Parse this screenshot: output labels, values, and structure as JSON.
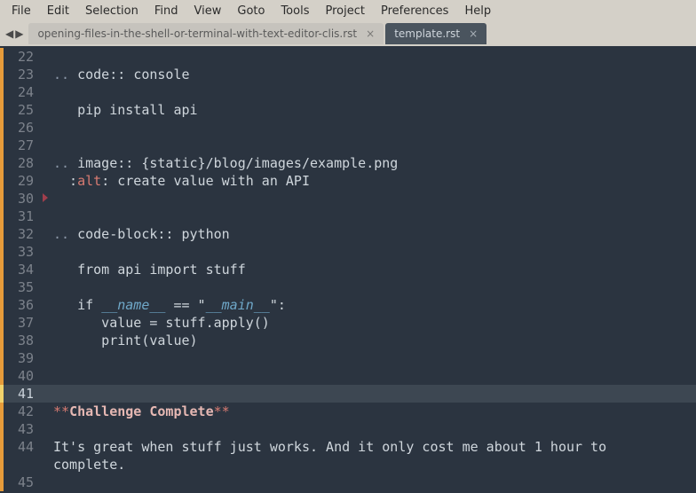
{
  "menubar": {
    "items": [
      "File",
      "Edit",
      "Selection",
      "Find",
      "View",
      "Goto",
      "Tools",
      "Project",
      "Preferences",
      "Help"
    ]
  },
  "tabs": [
    {
      "label": "opening-files-in-the-shell-or-terminal-with-text-editor-clis.rst",
      "active": false
    },
    {
      "label": "template.rst",
      "active": true
    }
  ],
  "editor": {
    "first_line": 22,
    "current_line": 41,
    "fold_marker_line": 30,
    "lines": [
      {
        "n": 22,
        "segs": []
      },
      {
        "n": 23,
        "segs": [
          [
            "dots",
            ".. "
          ],
          [
            "dir",
            "code"
          ],
          [
            "colon",
            ":: "
          ],
          [
            "arg",
            "console"
          ]
        ]
      },
      {
        "n": 24,
        "segs": []
      },
      {
        "n": 25,
        "segs": [
          [
            "plain",
            "   pip install api"
          ]
        ]
      },
      {
        "n": 26,
        "segs": []
      },
      {
        "n": 27,
        "segs": []
      },
      {
        "n": 28,
        "segs": [
          [
            "dots",
            ".. "
          ],
          [
            "dir",
            "image"
          ],
          [
            "colon",
            ":: "
          ],
          [
            "arg",
            "{static}/blog/images/example.png"
          ]
        ]
      },
      {
        "n": 29,
        "segs": [
          [
            "plain",
            "  :"
          ],
          [
            "alt",
            "alt"
          ],
          [
            "plain",
            ": create value with an API"
          ]
        ]
      },
      {
        "n": 30,
        "segs": []
      },
      {
        "n": 31,
        "segs": []
      },
      {
        "n": 32,
        "segs": [
          [
            "dots",
            ".. "
          ],
          [
            "dir",
            "code-block"
          ],
          [
            "colon",
            ":: "
          ],
          [
            "arg",
            "python"
          ]
        ]
      },
      {
        "n": 33,
        "segs": []
      },
      {
        "n": 34,
        "segs": [
          [
            "plain",
            "   from api import stuff"
          ]
        ]
      },
      {
        "n": 35,
        "segs": []
      },
      {
        "n": 36,
        "segs": [
          [
            "plain",
            "   if "
          ],
          [
            "dunder",
            "__name__"
          ],
          [
            "plain",
            " == \""
          ],
          [
            "dunder",
            "__main__"
          ],
          [
            "plain",
            "\":"
          ]
        ]
      },
      {
        "n": 37,
        "segs": [
          [
            "plain",
            "      value = stuff.apply()"
          ]
        ]
      },
      {
        "n": 38,
        "segs": [
          [
            "plain",
            "      print(value)"
          ]
        ]
      },
      {
        "n": 39,
        "segs": []
      },
      {
        "n": 40,
        "segs": []
      },
      {
        "n": 41,
        "segs": []
      },
      {
        "n": 42,
        "segs": [
          [
            "bold",
            "**"
          ],
          [
            "boldin",
            "Challenge Complete"
          ],
          [
            "bold",
            "**"
          ]
        ]
      },
      {
        "n": 43,
        "segs": []
      },
      {
        "n": 44,
        "segs": [
          [
            "plain",
            "It's great when stuff just works. And it only cost me about 1 hour to "
          ]
        ],
        "wrap": "complete."
      },
      {
        "n": 45,
        "segs": []
      }
    ]
  }
}
